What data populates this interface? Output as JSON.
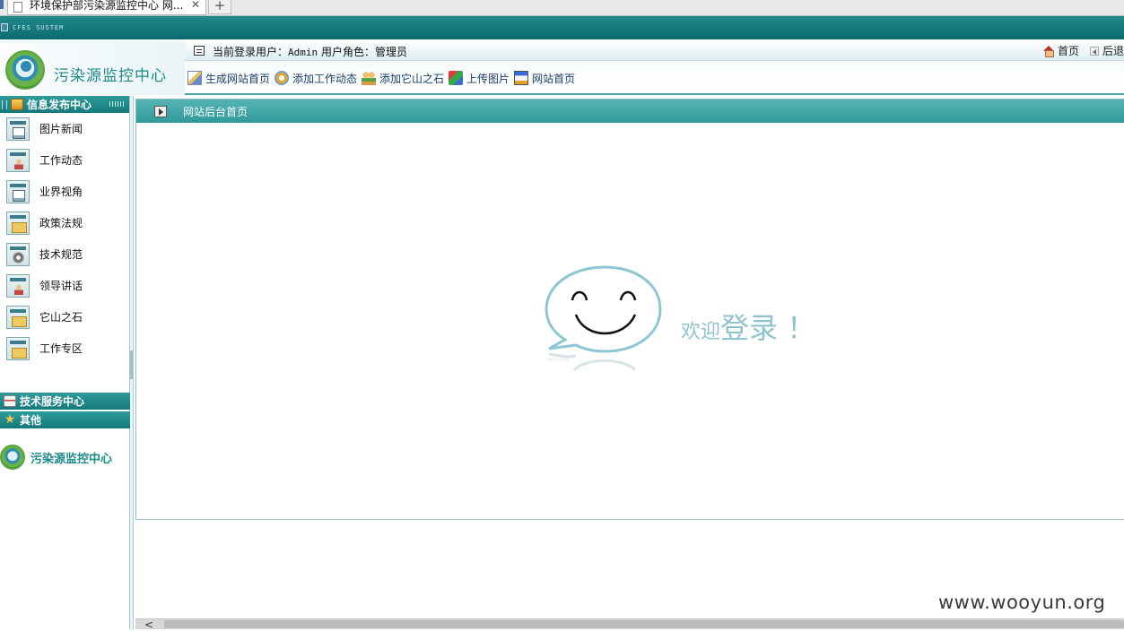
{
  "browser": {
    "tab_title": "环境保护部污染源监控中心 网...",
    "close_glyph": "✕",
    "new_tab_glyph": "+"
  },
  "system": {
    "label": "CFES SUSTEM"
  },
  "header": {
    "logo_text": "污染源监控中心",
    "user_label": "当前登录用户：",
    "user_name": "Admin",
    "role_label": " 用户角色：",
    "role_name": "管理员",
    "home_link": "首页",
    "back_link": "后退"
  },
  "toolbar": {
    "items": [
      {
        "label": "生成网站首页",
        "icon": "pencil-icon"
      },
      {
        "label": "添加工作动态",
        "icon": "gear-icon"
      },
      {
        "label": "添加它山之石",
        "icon": "people-icon"
      },
      {
        "label": "上传图片",
        "icon": "cubes-icon"
      },
      {
        "label": "网站首页",
        "icon": "screen-icon"
      }
    ]
  },
  "sidebar": {
    "section_title": "信息发布中心",
    "items": [
      {
        "label": "图片新闻",
        "icon": "news-doc-icon"
      },
      {
        "label": "工作动态",
        "icon": "person-icon"
      },
      {
        "label": "业界视角",
        "icon": "news-doc-icon"
      },
      {
        "label": "政策法规",
        "icon": "folder-icon"
      },
      {
        "label": "技术规范",
        "icon": "gear-icon"
      },
      {
        "label": "领导讲话",
        "icon": "person-icon"
      },
      {
        "label": "它山之石",
        "icon": "folder-icon"
      },
      {
        "label": "工作专区",
        "icon": "folder-icon"
      }
    ],
    "sections": [
      {
        "label": "技术服务中心",
        "icon": "calendar-icon"
      },
      {
        "label": "其他",
        "icon": "star-icon"
      }
    ],
    "footer_logo_text": "污染源监控中心"
  },
  "main": {
    "breadcrumb": "网站后台首页",
    "welcome_small": "欢迎",
    "welcome_large": "登录 ！"
  },
  "scrollbar": {
    "left_arrow": "<"
  },
  "watermark": "www.wooyun.org",
  "colors": {
    "teal_dark": "#16797c",
    "teal_light": "#56b3b3",
    "logo_text": "#1f8a8a",
    "welcome_text": "#8fc3cf"
  }
}
